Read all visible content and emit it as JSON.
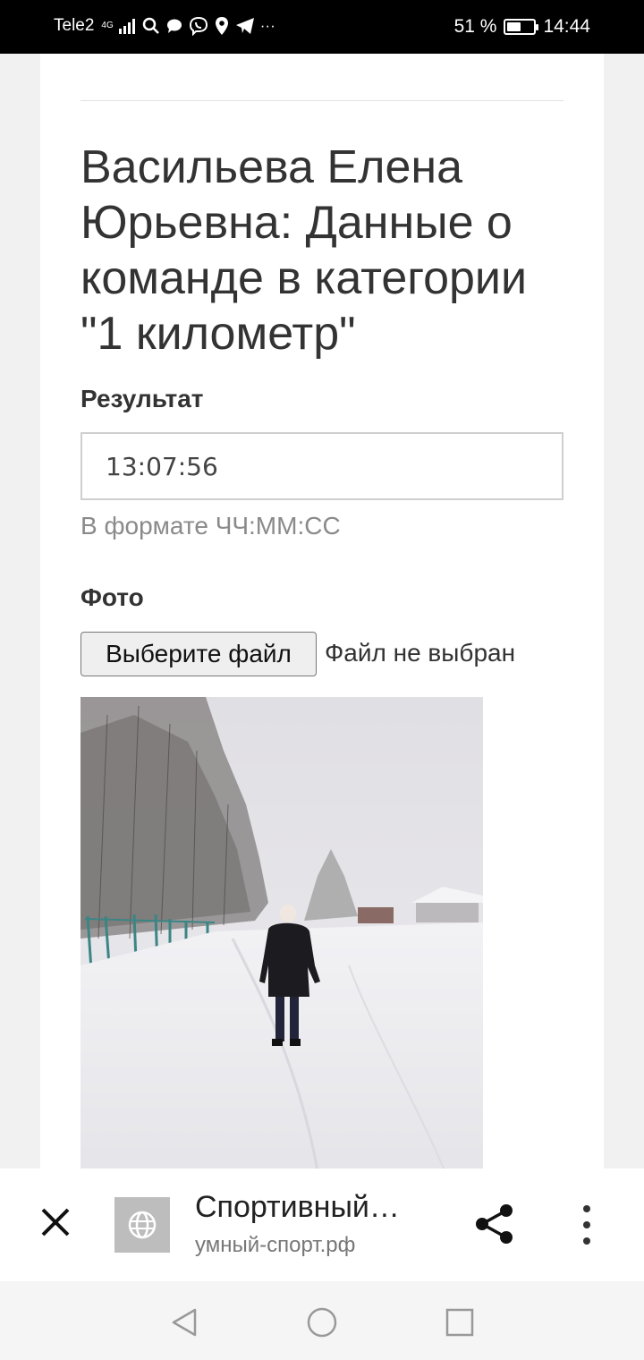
{
  "status_bar": {
    "carrier": "Tele2",
    "network": "4G",
    "battery_text": "51 %",
    "battery_level": 0.51,
    "time": "14:44",
    "icons": [
      "signal-icon",
      "search-icon",
      "chat-icon",
      "viber-icon",
      "location-icon",
      "telegram-icon",
      "more-notifications-icon"
    ]
  },
  "page": {
    "title": "Васильева Елена Юрьевна: Данные о команде в категории \"1 километр\"",
    "result": {
      "label": "Результат",
      "value": "13:07:56",
      "hint": "В формате ЧЧ:ММ:СС"
    },
    "photo": {
      "label": "Фото",
      "button_label": "Выберите файл",
      "file_status": "Файл не выбран"
    }
  },
  "browser_bar": {
    "site_title": "Спортивный…",
    "site_url": "умный-спорт.рф",
    "icons": [
      "close-icon",
      "globe-icon",
      "share-icon",
      "more-vert-icon"
    ]
  },
  "nav_bar": {
    "icons": [
      "back-icon",
      "home-icon",
      "recents-icon"
    ]
  },
  "colors": {
    "status_bar_bg": "#000000",
    "page_bg": "#ffffff",
    "outer_bg": "#f1f1f1",
    "text": "#333333",
    "hint": "#8a8a8a"
  }
}
